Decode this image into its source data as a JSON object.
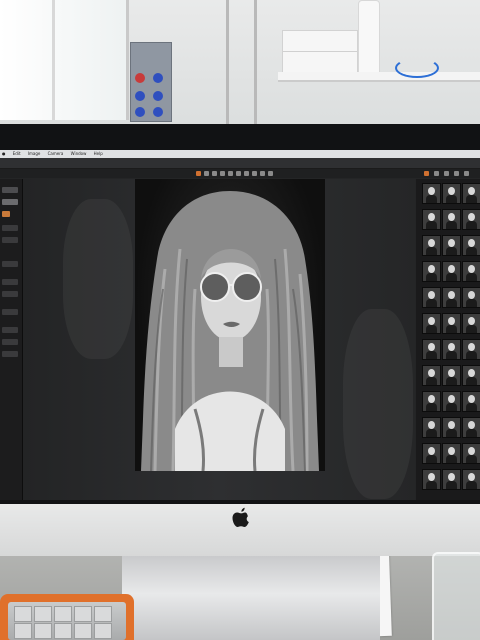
{
  "screen": {
    "menubar": [
      "Edit",
      "Image",
      "Camera",
      "Window",
      "Help"
    ],
    "window_title": ""
  },
  "photo": {
    "subject": ""
  },
  "filmstrip": {
    "thumbnail_rows": 12,
    "thumbnail_cols": 3
  },
  "monitor": {
    "logo": "apple-logo-icon"
  },
  "colors": {
    "bezel": "#111214",
    "chin": "#e3e4e4",
    "drive": "#e0702b",
    "cable": "#2d6fd6"
  }
}
